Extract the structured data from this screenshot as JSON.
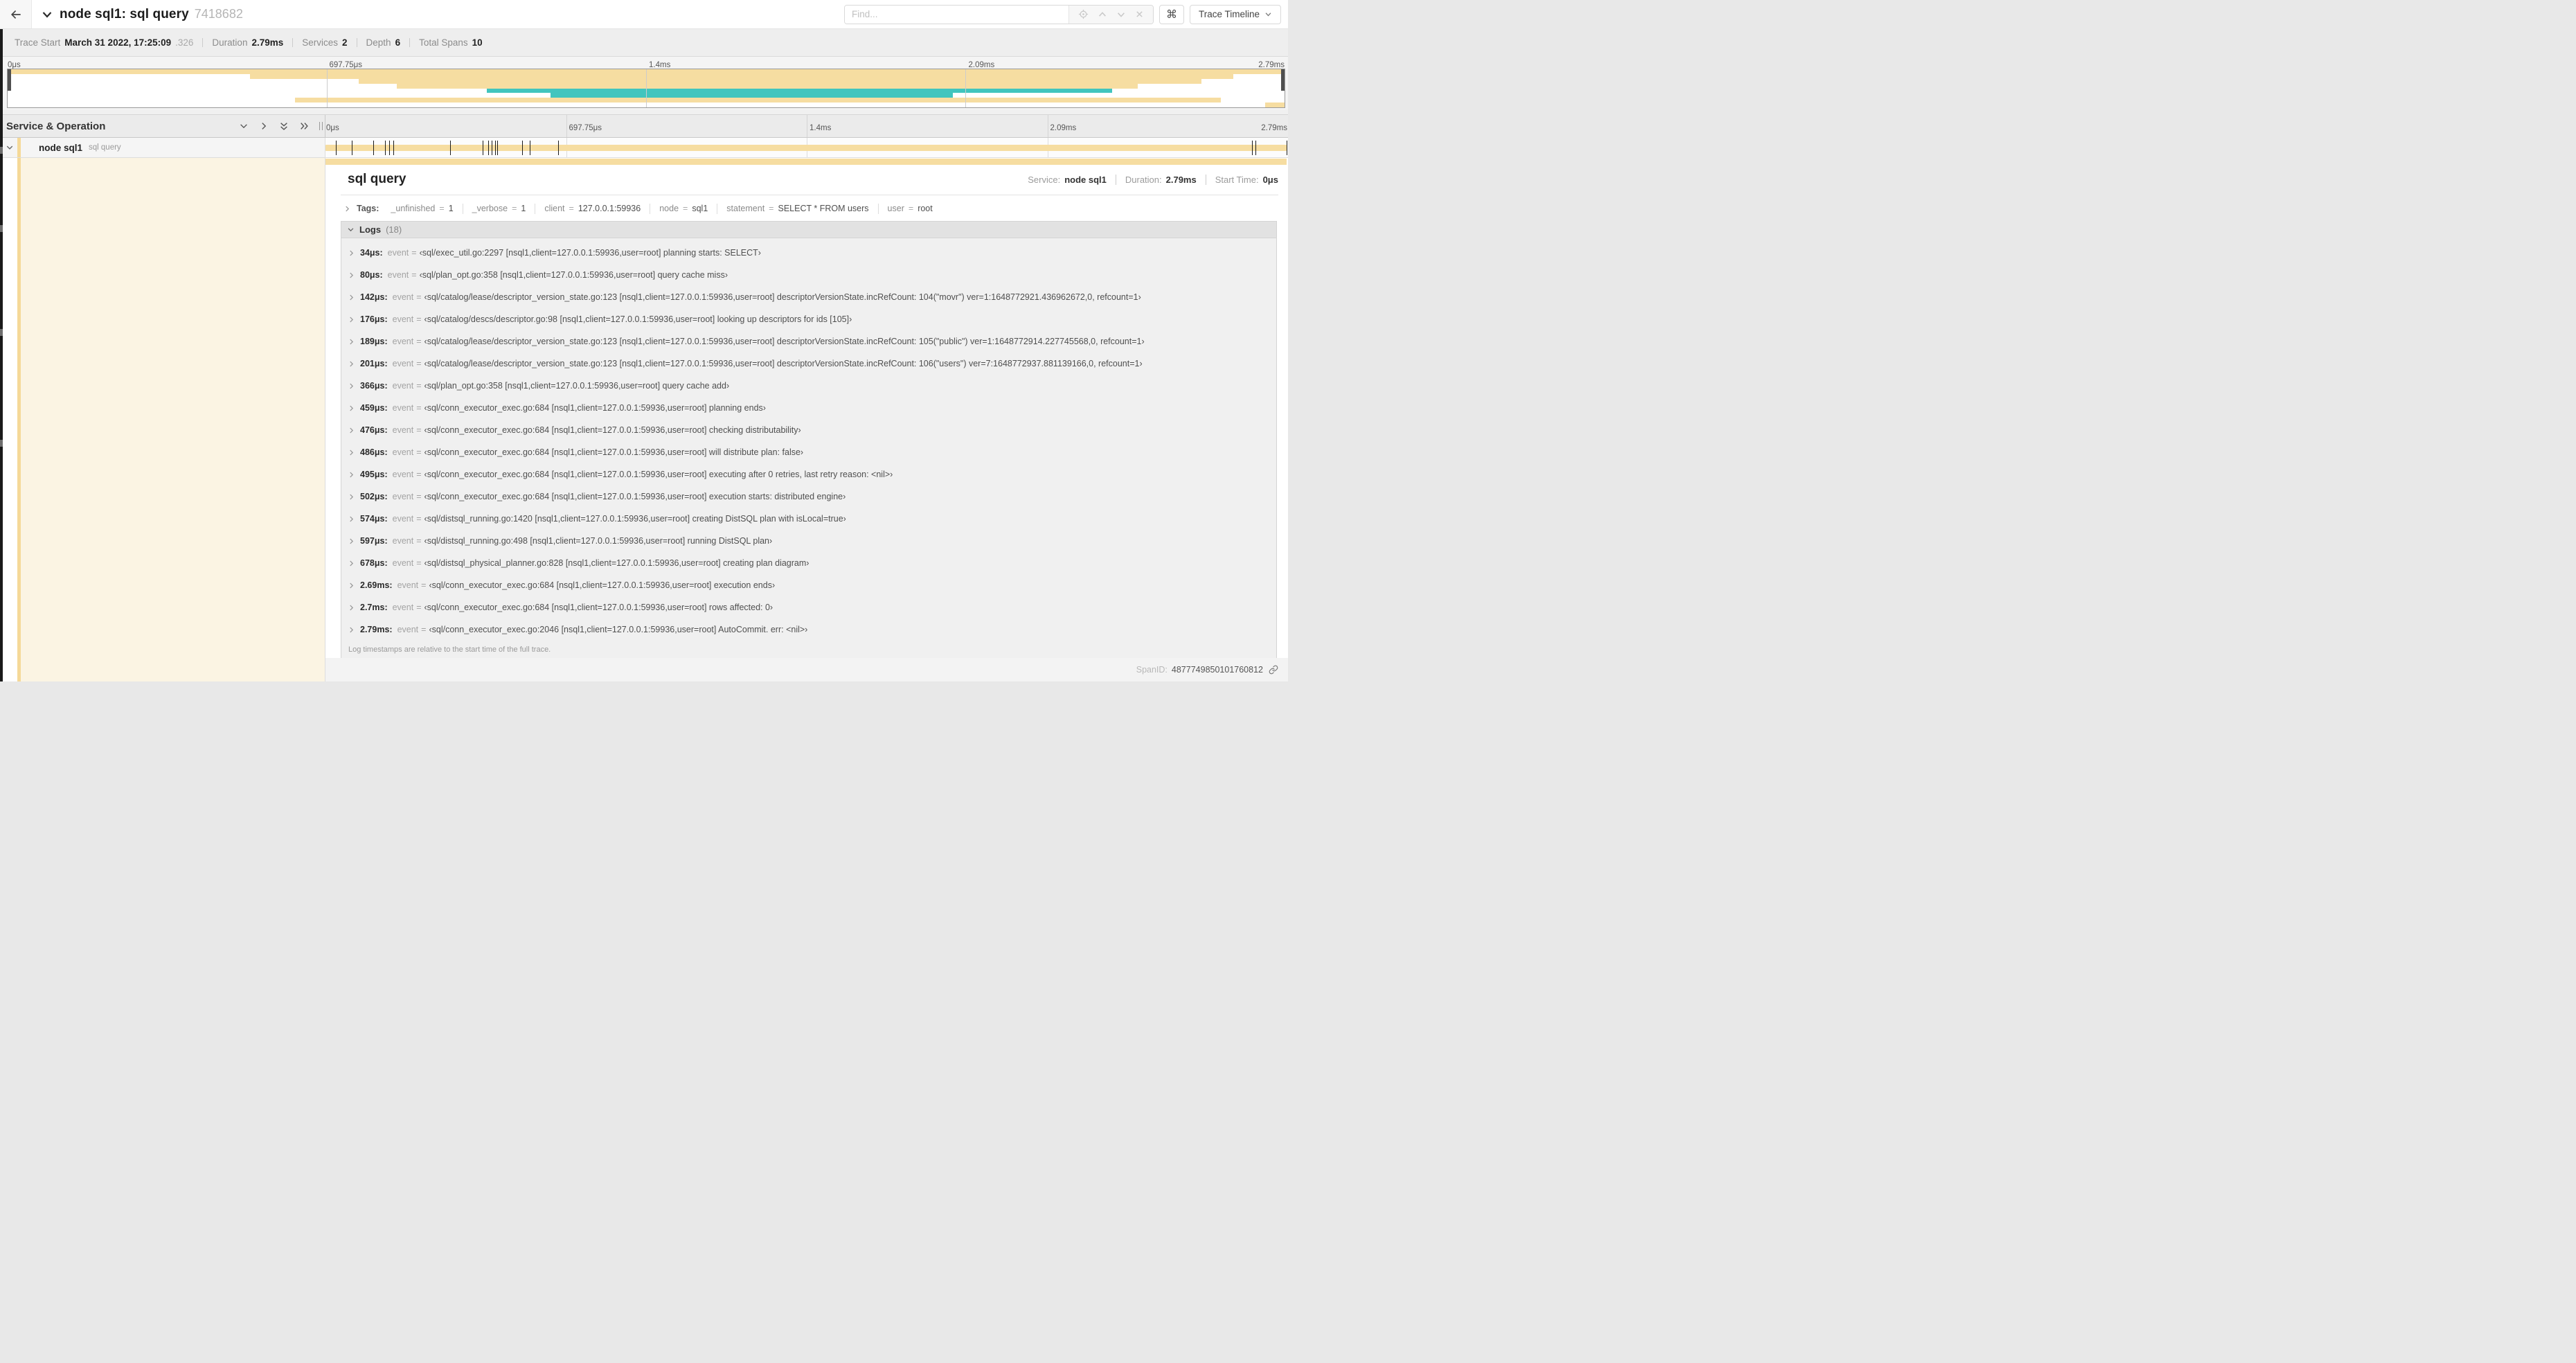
{
  "header": {
    "title": "node sql1: sql query",
    "trace_id": "7418682",
    "find": {
      "placeholder": "Find..."
    },
    "keyboard_icon": "⌘",
    "view_menu": {
      "label": "Trace Timeline"
    }
  },
  "summary": {
    "items": [
      {
        "label": "Trace Start",
        "value": "March 31 2022, 17:25:09",
        "suffix": ".326"
      },
      {
        "label": "Duration",
        "value": "2.79ms"
      },
      {
        "label": "Services",
        "value": "2"
      },
      {
        "label": "Depth",
        "value": "6"
      },
      {
        "label": "Total Spans",
        "value": "10"
      }
    ]
  },
  "timeline": {
    "duration_us": 2790,
    "left_header": "Service & Operation",
    "ticks": [
      {
        "label": "0μs",
        "pos": 0
      },
      {
        "label": "697.75μs",
        "pos": 0.25
      },
      {
        "label": "1.4ms",
        "pos": 0.5
      },
      {
        "label": "2.09ms",
        "pos": 0.75
      },
      {
        "label": "2.79ms",
        "pos": 1
      }
    ],
    "span_row": {
      "service": "node sql1",
      "operation": "sql query"
    },
    "minimap_spans": [
      {
        "row": 0,
        "start": 0.0,
        "end": 1.0,
        "color": "tan"
      },
      {
        "row": 1,
        "start": 0.19,
        "end": 0.96,
        "color": "tan"
      },
      {
        "row": 2,
        "start": 0.275,
        "end": 0.935,
        "color": "tan"
      },
      {
        "row": 3,
        "start": 0.305,
        "end": 0.885,
        "color": "tan"
      },
      {
        "row": 4,
        "start": 0.375,
        "end": 0.865,
        "color": "teal"
      },
      {
        "row": 5,
        "start": 0.425,
        "end": 0.74,
        "color": "teal"
      },
      {
        "row": 6,
        "start": 0.225,
        "end": 0.95,
        "color": "tan"
      },
      {
        "row": 7,
        "start": 0.985,
        "end": 1.0,
        "color": "tan"
      }
    ]
  },
  "detail": {
    "title": "sql query",
    "meta": [
      {
        "label": "Service:",
        "value": "node sql1"
      },
      {
        "label": "Duration:",
        "value": "2.79ms"
      },
      {
        "label": "Start Time:",
        "value": "0μs"
      }
    ],
    "tags_label": "Tags:",
    "kv_separator": "=",
    "tags": [
      {
        "key": "_unfinished",
        "value": "1"
      },
      {
        "key": "_verbose",
        "value": "1"
      },
      {
        "key": "client",
        "value": "127.0.0.1:59936"
      },
      {
        "key": "node",
        "value": "sql1"
      },
      {
        "key": "statement",
        "value": "SELECT * FROM users"
      },
      {
        "key": "user",
        "value": "root"
      }
    ],
    "logs": {
      "label": "Logs",
      "count": "(18)",
      "event_key": "event",
      "entries": [
        {
          "time": "34μs:",
          "time_us": 34,
          "text": "‹sql/exec_util.go:2297 [nsql1,client=127.0.0.1:59936,user=root] planning starts: SELECT›"
        },
        {
          "time": "80μs:",
          "time_us": 80,
          "text": "‹sql/plan_opt.go:358 [nsql1,client=127.0.0.1:59936,user=root] query cache miss›"
        },
        {
          "time": "142μs:",
          "time_us": 142,
          "text": "‹sql/catalog/lease/descriptor_version_state.go:123 [nsql1,client=127.0.0.1:59936,user=root] descriptorVersionState.incRefCount: 104(\"movr\") ver=1:1648772921.436962672,0, refcount=1›"
        },
        {
          "time": "176μs:",
          "time_us": 176,
          "text": "‹sql/catalog/descs/descriptor.go:98 [nsql1,client=127.0.0.1:59936,user=root] looking up descriptors for ids [105]›"
        },
        {
          "time": "189μs:",
          "time_us": 189,
          "text": "‹sql/catalog/lease/descriptor_version_state.go:123 [nsql1,client=127.0.0.1:59936,user=root] descriptorVersionState.incRefCount: 105(\"public\") ver=1:1648772914.227745568,0, refcount=1›"
        },
        {
          "time": "201μs:",
          "time_us": 201,
          "text": "‹sql/catalog/lease/descriptor_version_state.go:123 [nsql1,client=127.0.0.1:59936,user=root] descriptorVersionState.incRefCount: 106(\"users\") ver=7:1648772937.881139166,0, refcount=1›"
        },
        {
          "time": "366μs:",
          "time_us": 366,
          "text": "‹sql/plan_opt.go:358 [nsql1,client=127.0.0.1:59936,user=root] query cache add›"
        },
        {
          "time": "459μs:",
          "time_us": 459,
          "text": "‹sql/conn_executor_exec.go:684 [nsql1,client=127.0.0.1:59936,user=root] planning ends›"
        },
        {
          "time": "476μs:",
          "time_us": 476,
          "text": "‹sql/conn_executor_exec.go:684 [nsql1,client=127.0.0.1:59936,user=root] checking distributability›"
        },
        {
          "time": "486μs:",
          "time_us": 486,
          "text": "‹sql/conn_executor_exec.go:684 [nsql1,client=127.0.0.1:59936,user=root] will distribute plan: false›"
        },
        {
          "time": "495μs:",
          "time_us": 495,
          "text": "‹sql/conn_executor_exec.go:684 [nsql1,client=127.0.0.1:59936,user=root] executing after 0 retries, last retry reason: <nil>›"
        },
        {
          "time": "502μs:",
          "time_us": 502,
          "text": "‹sql/conn_executor_exec.go:684 [nsql1,client=127.0.0.1:59936,user=root] execution starts: distributed engine›"
        },
        {
          "time": "574μs:",
          "time_us": 574,
          "text": "‹sql/distsql_running.go:1420 [nsql1,client=127.0.0.1:59936,user=root] creating DistSQL plan with isLocal=true›"
        },
        {
          "time": "597μs:",
          "time_us": 597,
          "text": "‹sql/distsql_running.go:498 [nsql1,client=127.0.0.1:59936,user=root] running DistSQL plan›"
        },
        {
          "time": "678μs:",
          "time_us": 678,
          "text": "‹sql/distsql_physical_planner.go:828 [nsql1,client=127.0.0.1:59936,user=root] creating plan diagram›"
        },
        {
          "time": "2.69ms:",
          "time_us": 2690,
          "text": "‹sql/conn_executor_exec.go:684 [nsql1,client=127.0.0.1:59936,user=root] execution ends›"
        },
        {
          "time": "2.7ms:",
          "time_us": 2700,
          "text": "‹sql/conn_executor_exec.go:684 [nsql1,client=127.0.0.1:59936,user=root] rows affected: 0›"
        },
        {
          "time": "2.79ms:",
          "time_us": 2790,
          "text": "‹sql/conn_executor_exec.go:2046 [nsql1,client=127.0.0.1:59936,user=root] AutoCommit. err: <nil>›"
        }
      ],
      "footer": "Log timestamps are relative to the start time of the full trace."
    },
    "span_id_label": "SpanID:",
    "span_id": "4877749850101760812"
  },
  "colors": {
    "tan": "#f6dda1",
    "teal": "#41c5be",
    "accent": "#f5d998",
    "cream": "#fbf4e3"
  }
}
